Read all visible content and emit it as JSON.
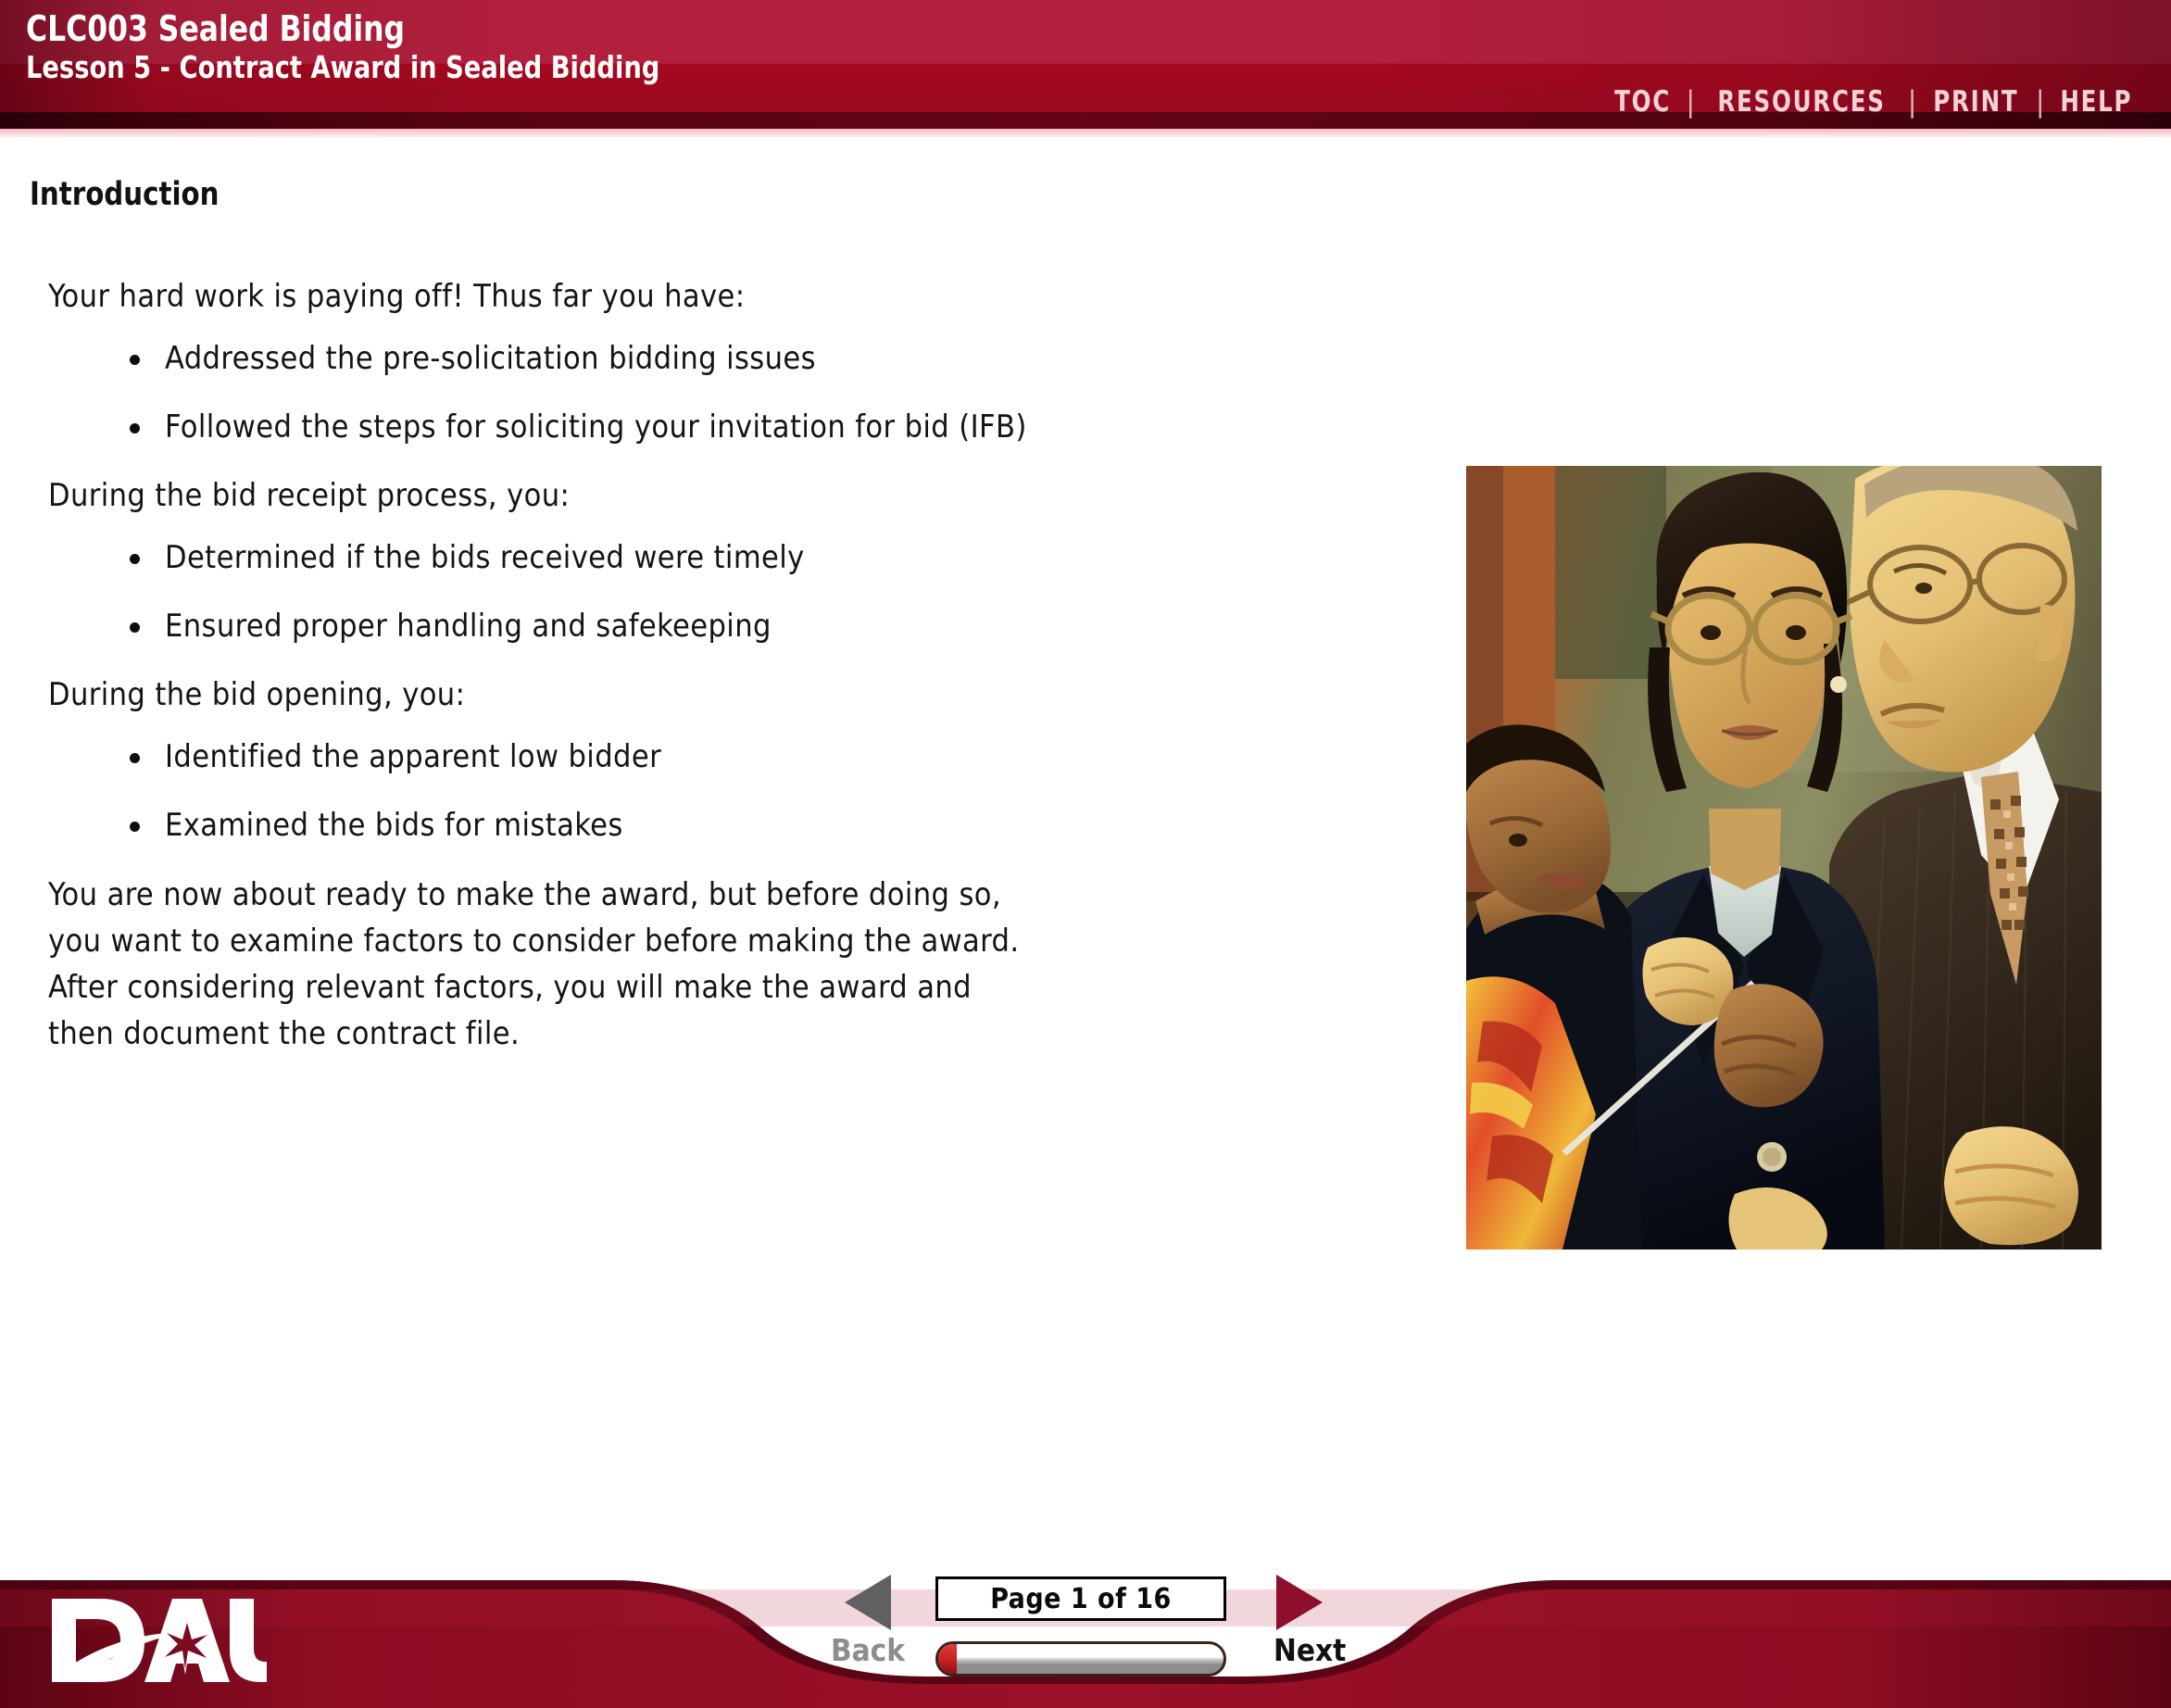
{
  "header": {
    "course_title": "CLC003 Sealed Bidding",
    "lesson_title": "Lesson 5 - Contract Award in Sealed Bidding",
    "nav": [
      {
        "label": "TOC",
        "name": "toc"
      },
      {
        "label": "RESOURCES",
        "name": "resources"
      },
      {
        "label": "PRINT",
        "name": "print"
      },
      {
        "label": "HELP",
        "name": "help"
      }
    ],
    "separator": "|",
    "colors": {
      "brand_red": "#a4091f",
      "brand_red_light": "#b2203d",
      "brand_red_dark": "#5c0512",
      "pink_rule": "#f6b9c3"
    }
  },
  "content": {
    "section_heading": "Introduction",
    "intro_paragraph": "Your hard work is paying off! Thus far you have:",
    "list_one": [
      "Addressed the pre-solicitation bidding issues",
      "Followed the steps for soliciting your invitation for bid (IFB)"
    ],
    "paragraph_two": "During the bid receipt process, you:",
    "list_two": [
      "Determined if the bids received were timely",
      "Ensured proper handling and safekeeping"
    ],
    "paragraph_three": "During the bid opening, you:",
    "list_three": [
      "Identified the apparent low bidder",
      "Examined the bids for mistakes"
    ],
    "closing_paragraph": "You are now about ready to make the award, but before doing so,\nyou want to examine factors to consider before making the award.\nAfter considering relevant factors, you will make the award and\nthen document the contract file.",
    "photo_alt": "Three business professionals in suits conversing, woman with glasses in center"
  },
  "footer": {
    "logo_text": "DAU",
    "back_label": "Back",
    "next_label": "Next",
    "page_indicator": "Page 1 of 16",
    "current_page": 1,
    "total_pages": 16,
    "progress_percent": 6,
    "colors": {
      "footer_red": "#8a0b22",
      "back_disabled": "#8d8d8d",
      "next_enabled": "#111111"
    }
  }
}
